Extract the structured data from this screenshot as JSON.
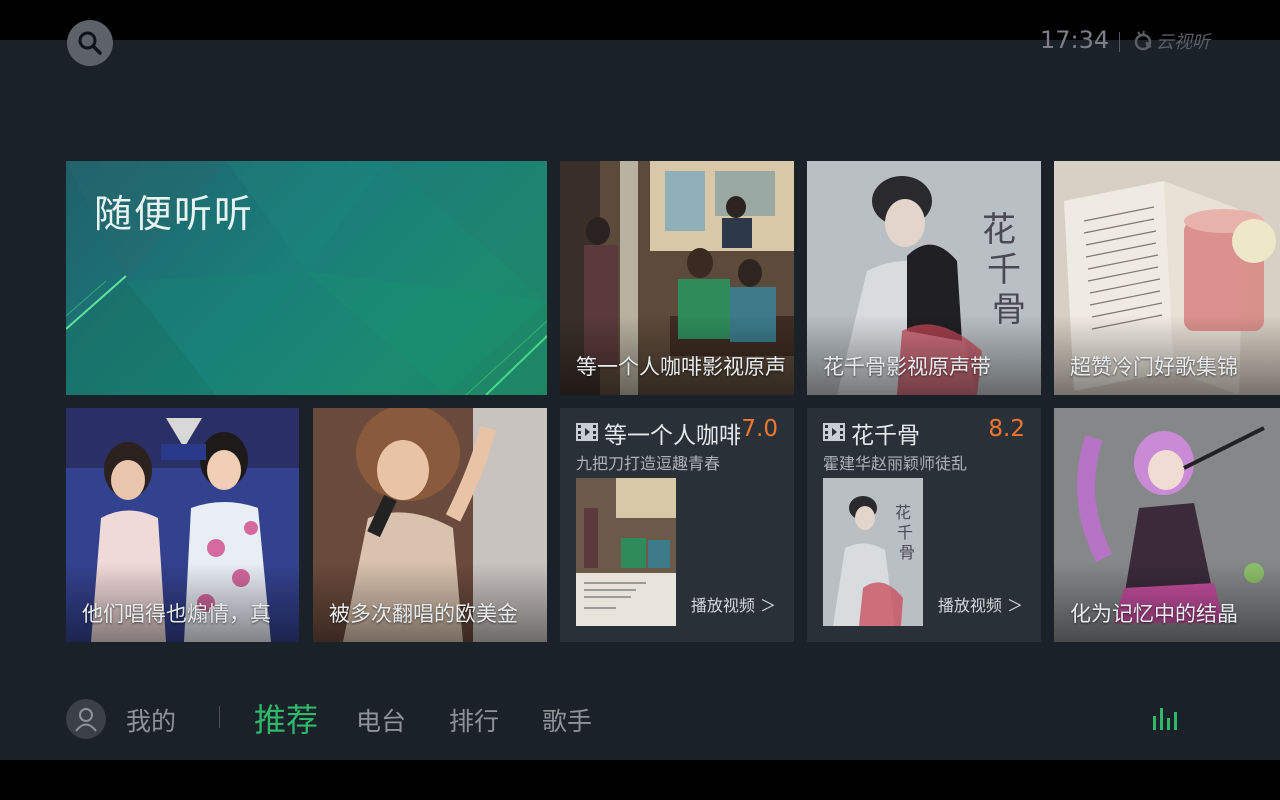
{
  "status": {
    "time": "17:34",
    "brand": "云视听"
  },
  "hero": {
    "title": "随便听听"
  },
  "tiles": {
    "cafe": {
      "label": "等一个人咖啡影视原声"
    },
    "hua": {
      "label": "花千骨影视原声带"
    },
    "cold": {
      "label": "超赞冷门好歌集锦"
    },
    "voice": {
      "label": "他们唱得也煽情，真"
    },
    "cover": {
      "label": "被多次翻唱的欧美金"
    },
    "crystal": {
      "label": "化为记忆中的结晶"
    }
  },
  "cards": {
    "cafe": {
      "title": "等一个人咖啡",
      "score": "7.0",
      "subtitle": "九把刀打造逗趣青春",
      "play": "播放视频 ＞"
    },
    "hua": {
      "title": "花千骨",
      "score": "8.2",
      "subtitle": "霍建华赵丽颖师徒乱",
      "play": "播放视频 ＞"
    }
  },
  "nav": {
    "mine": "我的",
    "recommend": "推荐",
    "radio": "电台",
    "rank": "排行",
    "singer": "歌手"
  },
  "colors": {
    "accent": "#2fb86a",
    "score": "#f0772b"
  }
}
